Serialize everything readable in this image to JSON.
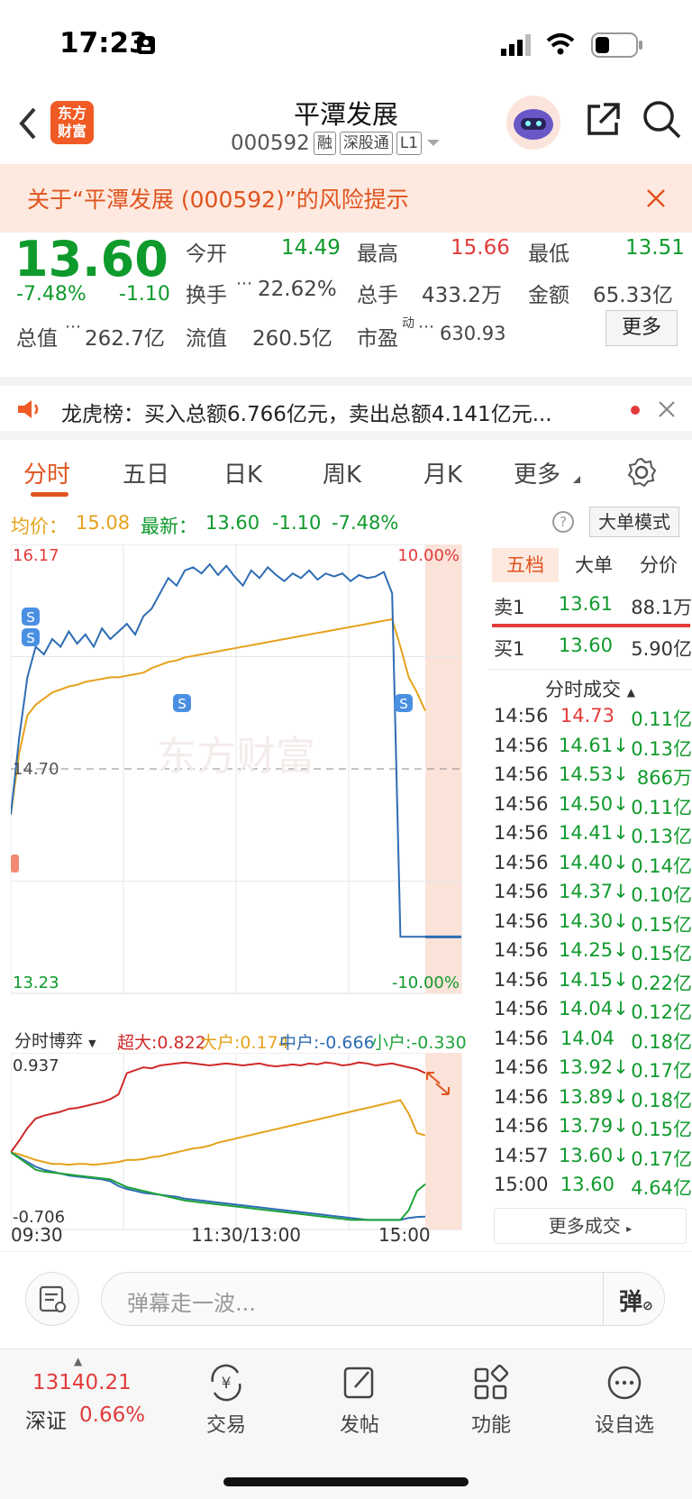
{
  "status_bar": {
    "time": "17:23"
  },
  "header": {
    "logo_text": "东方\n财富",
    "stock_name": "平潭发展",
    "stock_code": "000592",
    "tags": [
      "融",
      "深股通",
      "L1"
    ]
  },
  "risk_banner": {
    "text": "关于“平潭发展 (000592)”的风险提示"
  },
  "quote": {
    "price": "13.60",
    "change_pct": "-7.48%",
    "change": "-1.10",
    "fields": [
      {
        "label": "今开",
        "value": "14.49",
        "color": "#0f9a2c"
      },
      {
        "label": "最高",
        "value": "15.66",
        "color": "#e33b3b"
      },
      {
        "label": "最低",
        "value": "13.51",
        "color": "#0f9a2c"
      },
      {
        "label": "换手",
        "value": "22.62%",
        "color": "#444444"
      },
      {
        "label": "总手",
        "value": "433.2万",
        "color": "#444444"
      },
      {
        "label": "金额",
        "value": "65.33亿",
        "color": "#444444"
      },
      {
        "label": "总值",
        "value": "262.7亿",
        "color": "#444444"
      },
      {
        "label": "流值",
        "value": "260.5亿",
        "color": "#444444"
      },
      {
        "label": "市盈",
        "sup": "动",
        "value": "630.93",
        "color": "#444444"
      }
    ],
    "more_button": "更多"
  },
  "dragon_tiger": {
    "text": "龙虎榜：买入总额6.766亿元，卖出总额4.141亿元..."
  },
  "tabs": [
    "分时",
    "五日",
    "日K",
    "周K",
    "月K",
    "更多"
  ],
  "summary": {
    "avg_label": "均价：",
    "avg_value": "15.08",
    "latest_label": "最新：",
    "latest_value": "13.60",
    "change": "-1.10",
    "change_pct": "-7.48%",
    "big_order_mode": "大单模式"
  },
  "chart_data": {
    "type": "line",
    "y_max_label": "16.17",
    "y_min_label": "13.23",
    "pct_max_label": "10.00%",
    "pct_min_label": "-10.00%",
    "prev_close_label": "14.70",
    "ylim": [
      13.23,
      16.17
    ],
    "watermark": "东方财富",
    "x_ticks": [
      "09:30",
      "11:30/13:00",
      "15:00"
    ],
    "price": [
      14.4,
      14.9,
      15.3,
      15.5,
      15.45,
      15.55,
      15.5,
      15.6,
      15.52,
      15.58,
      15.5,
      15.62,
      15.55,
      15.6,
      15.65,
      15.58,
      15.7,
      15.75,
      15.85,
      15.95,
      15.9,
      16.0,
      16.02,
      15.98,
      16.04,
      15.97,
      16.03,
      15.96,
      15.9,
      16.0,
      15.95,
      16.02,
      15.97,
      15.93,
      15.98,
      15.95,
      16.0,
      15.94,
      15.98,
      15.96,
      15.98,
      15.93,
      15.97,
      15.95,
      15.96,
      15.99,
      15.85,
      13.6,
      13.6,
      13.6,
      13.6
    ],
    "avg": [
      14.4,
      14.8,
      15.05,
      15.12,
      15.16,
      15.2,
      15.22,
      15.24,
      15.25,
      15.27,
      15.28,
      15.29,
      15.3,
      15.3,
      15.31,
      15.32,
      15.33,
      15.36,
      15.38,
      15.4,
      15.41,
      15.43,
      15.44,
      15.45,
      15.46,
      15.47,
      15.48,
      15.49,
      15.5,
      15.51,
      15.52,
      15.53,
      15.54,
      15.55,
      15.56,
      15.57,
      15.58,
      15.59,
      15.6,
      15.61,
      15.62,
      15.63,
      15.64,
      15.65,
      15.66,
      15.67,
      15.68,
      15.5,
      15.3,
      15.2,
      15.08
    ],
    "game": {
      "label": "分时博弈",
      "series": [
        {
          "name": "超大",
          "value": "0.822",
          "color": "#d02a2a",
          "values": [
            0.0,
            0.12,
            0.25,
            0.35,
            0.38,
            0.4,
            0.42,
            0.45,
            0.46,
            0.48,
            0.5,
            0.52,
            0.55,
            0.6,
            0.82,
            0.85,
            0.88,
            0.87,
            0.9,
            0.91,
            0.92,
            0.93,
            0.92,
            0.91,
            0.9,
            0.91,
            0.92,
            0.91,
            0.9,
            0.91,
            0.92,
            0.9,
            0.89,
            0.9,
            0.91,
            0.9,
            0.92,
            0.91,
            0.93,
            0.92,
            0.9,
            0.91,
            0.93,
            0.92,
            0.9,
            0.91,
            0.92,
            0.9,
            0.88,
            0.86,
            0.82
          ]
        },
        {
          "name": "大户",
          "value": "0.174",
          "color": "#e5a21c",
          "values": [
            0.0,
            -0.02,
            -0.05,
            -0.08,
            -0.1,
            -0.12,
            -0.12,
            -0.13,
            -0.12,
            -0.12,
            -0.13,
            -0.12,
            -0.11,
            -0.1,
            -0.08,
            -0.08,
            -0.07,
            -0.05,
            -0.04,
            -0.02,
            0.0,
            0.02,
            0.04,
            0.05,
            0.07,
            0.1,
            0.12,
            0.14,
            0.16,
            0.18,
            0.2,
            0.22,
            0.24,
            0.26,
            0.28,
            0.3,
            0.32,
            0.34,
            0.36,
            0.38,
            0.4,
            0.42,
            0.44,
            0.46,
            0.48,
            0.5,
            0.52,
            0.54,
            0.4,
            0.2,
            0.174
          ]
        },
        {
          "name": "中户",
          "value": "-0.666",
          "color": "#2e6db4",
          "values": [
            0.0,
            -0.05,
            -0.1,
            -0.15,
            -0.18,
            -0.2,
            -0.22,
            -0.24,
            -0.25,
            -0.26,
            -0.27,
            -0.28,
            -0.3,
            -0.35,
            -0.38,
            -0.4,
            -0.42,
            -0.43,
            -0.44,
            -0.45,
            -0.46,
            -0.48,
            -0.49,
            -0.5,
            -0.51,
            -0.52,
            -0.53,
            -0.54,
            -0.55,
            -0.56,
            -0.57,
            -0.58,
            -0.59,
            -0.6,
            -0.61,
            -0.62,
            -0.63,
            -0.64,
            -0.65,
            -0.66,
            -0.67,
            -0.68,
            -0.69,
            -0.7,
            -0.7,
            -0.7,
            -0.7,
            -0.7,
            -0.68,
            -0.67,
            -0.666
          ]
        },
        {
          "name": "小户",
          "value": "-0.330",
          "color": "#1fa33a",
          "values": [
            0.0,
            -0.06,
            -0.12,
            -0.18,
            -0.2,
            -0.21,
            -0.22,
            -0.23,
            -0.24,
            -0.25,
            -0.26,
            -0.27,
            -0.28,
            -0.32,
            -0.36,
            -0.38,
            -0.4,
            -0.42,
            -0.44,
            -0.46,
            -0.48,
            -0.5,
            -0.51,
            -0.52,
            -0.53,
            -0.54,
            -0.55,
            -0.56,
            -0.57,
            -0.58,
            -0.59,
            -0.6,
            -0.61,
            -0.62,
            -0.63,
            -0.64,
            -0.65,
            -0.66,
            -0.67,
            -0.68,
            -0.69,
            -0.7,
            -0.7,
            -0.7,
            -0.7,
            -0.7,
            -0.7,
            -0.7,
            -0.6,
            -0.4,
            -0.33
          ]
        }
      ],
      "ymax_label": "0.937",
      "ymin_label": "-0.706",
      "ylim": [
        -0.706,
        0.937
      ]
    }
  },
  "order_book": {
    "tabs": [
      "五档",
      "大单",
      "分价"
    ],
    "sell1": {
      "label": "卖1",
      "price": "13.61",
      "volume": "88.1万"
    },
    "buy1": {
      "label": "买1",
      "price": "13.60",
      "volume": "5.90亿"
    },
    "trades_title": "分时成交",
    "trades": [
      {
        "time": "14:56",
        "price": "14.73",
        "vol": "0.11亿",
        "color": "#e33b3b"
      },
      {
        "time": "14:56",
        "price": "14.61↓",
        "vol": "0.13亿",
        "color": "#0f9a2c"
      },
      {
        "time": "14:56",
        "price": "14.53↓",
        "vol": "866万",
        "color": "#0f9a2c"
      },
      {
        "time": "14:56",
        "price": "14.50↓",
        "vol": "0.11亿",
        "color": "#0f9a2c"
      },
      {
        "time": "14:56",
        "price": "14.41↓",
        "vol": "0.13亿",
        "color": "#0f9a2c"
      },
      {
        "time": "14:56",
        "price": "14.40↓",
        "vol": "0.14亿",
        "color": "#0f9a2c"
      },
      {
        "time": "14:56",
        "price": "14.37↓",
        "vol": "0.10亿",
        "color": "#0f9a2c"
      },
      {
        "time": "14:56",
        "price": "14.30↓",
        "vol": "0.15亿",
        "color": "#0f9a2c"
      },
      {
        "time": "14:56",
        "price": "14.25↓",
        "vol": "0.15亿",
        "color": "#0f9a2c"
      },
      {
        "time": "14:56",
        "price": "14.15↓",
        "vol": "0.22亿",
        "color": "#0f9a2c"
      },
      {
        "time": "14:56",
        "price": "14.04↓",
        "vol": "0.12亿",
        "color": "#0f9a2c"
      },
      {
        "time": "14:56",
        "price": "14.04",
        "vol": "0.18亿",
        "color": "#0f9a2c"
      },
      {
        "time": "14:56",
        "price": "13.92↓",
        "vol": "0.17亿",
        "color": "#0f9a2c"
      },
      {
        "time": "14:56",
        "price": "13.89↓",
        "vol": "0.18亿",
        "color": "#0f9a2c"
      },
      {
        "time": "14:56",
        "price": "13.79↓",
        "vol": "0.15亿",
        "color": "#0f9a2c"
      },
      {
        "time": "14:57",
        "price": "13.60↓",
        "vol": "0.17亿",
        "color": "#0f9a2c"
      },
      {
        "time": "15:00",
        "price": "13.60",
        "vol": "4.64亿",
        "color": "#0f9a2c"
      }
    ],
    "more_trades": "更多成交"
  },
  "comment": {
    "placeholder": "弹幕走一波..."
  },
  "bottom_nav": {
    "index_value": "13140.21",
    "index_name": "深证",
    "index_change": "0.66%",
    "items": [
      {
        "label": "交易",
        "icon": "trade-icon"
      },
      {
        "label": "发帖",
        "icon": "post-icon"
      },
      {
        "label": "功能",
        "icon": "apps-icon"
      },
      {
        "label": "设自选",
        "icon": "more-icon"
      }
    ]
  }
}
